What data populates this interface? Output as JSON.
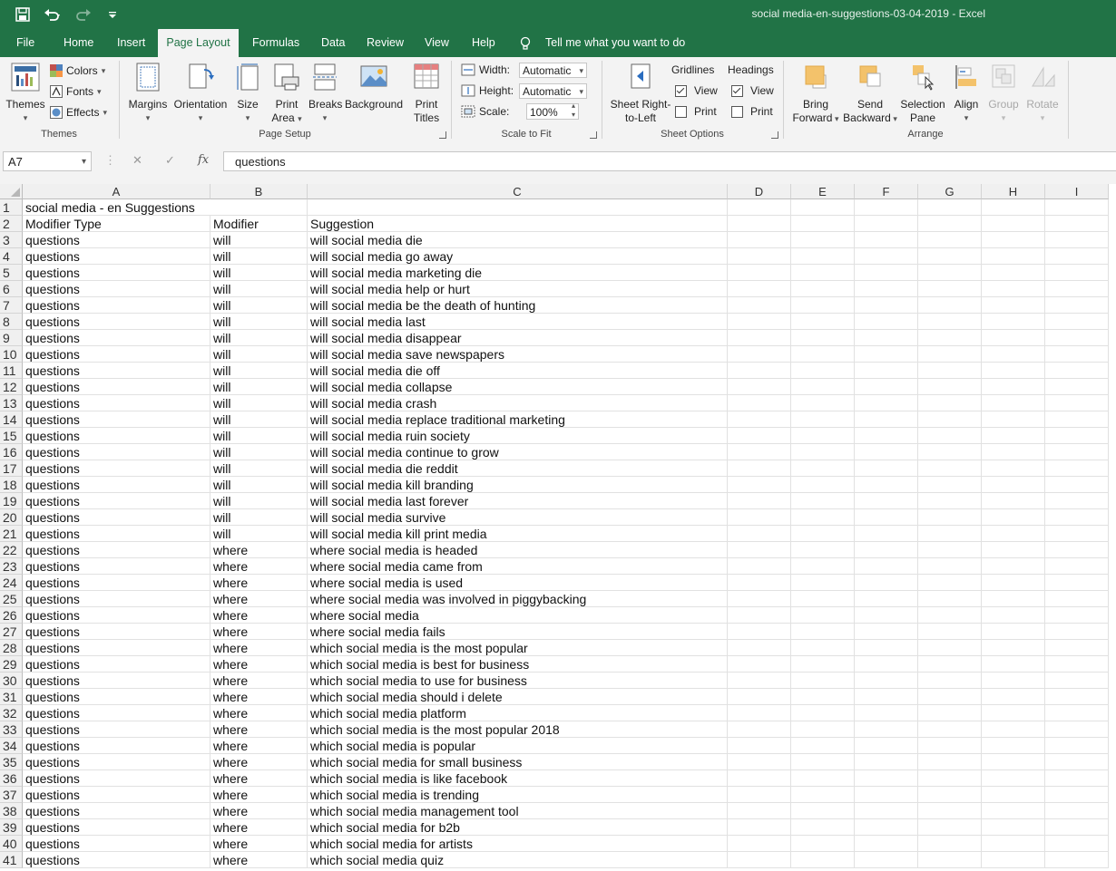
{
  "window": {
    "doc_title": "social media-en-suggestions-03-04-2019",
    "separator": " - ",
    "app_name": "Excel"
  },
  "tabs": [
    "File",
    "Home",
    "Insert",
    "Page Layout",
    "Formulas",
    "Data",
    "Review",
    "View",
    "Help"
  ],
  "active_tab": "Page Layout",
  "tell_me": "Tell me what you want to do",
  "ribbon": {
    "themes": {
      "themes_label": "Themes",
      "colors": "Colors",
      "fonts": "Fonts",
      "effects": "Effects",
      "group": "Themes"
    },
    "page_setup": {
      "margins": "Margins",
      "orientation": "Orientation",
      "size": "Size",
      "print_area_1": "Print",
      "print_area_2": "Area",
      "breaks": "Breaks",
      "background": "Background",
      "print_titles_1": "Print",
      "print_titles_2": "Titles",
      "group": "Page Setup"
    },
    "scale_to_fit": {
      "width_label": "Width:",
      "width_value": "Automatic",
      "height_label": "Height:",
      "height_value": "Automatic",
      "scale_label": "Scale:",
      "scale_value": "100%",
      "group": "Scale to Fit"
    },
    "sheet_options": {
      "rtl_1": "Sheet Right-",
      "rtl_2": "to-Left",
      "gridlines": "Gridlines",
      "headings": "Headings",
      "view": "View",
      "print": "Print",
      "group": "Sheet Options"
    },
    "arrange": {
      "bring_1": "Bring",
      "bring_2": "Forward",
      "send_1": "Send",
      "send_2": "Backward",
      "selection_1": "Selection",
      "selection_2": "Pane",
      "align": "Align",
      "group_btn": "Group",
      "rotate": "Rotate",
      "group": "Arrange"
    }
  },
  "formula_bar": {
    "name_box": "A7",
    "content": "questions"
  },
  "columns": [
    "A",
    "B",
    "C",
    "D",
    "E",
    "F",
    "G",
    "H",
    "I"
  ],
  "sheet": {
    "row1": {
      "a": "social media - en Suggestions",
      "b": "",
      "c": ""
    },
    "row2": {
      "a": "Modifier Type",
      "b": "Modifier",
      "c": "Suggestion"
    },
    "rows": [
      [
        "questions",
        "will",
        "will social media die"
      ],
      [
        "questions",
        "will",
        "will social media go away"
      ],
      [
        "questions",
        "will",
        "will social media marketing die"
      ],
      [
        "questions",
        "will",
        "will social media help or hurt"
      ],
      [
        "questions",
        "will",
        "will social media be the death of hunting"
      ],
      [
        "questions",
        "will",
        "will social media last"
      ],
      [
        "questions",
        "will",
        "will social media disappear"
      ],
      [
        "questions",
        "will",
        "will social media save newspapers"
      ],
      [
        "questions",
        "will",
        "will social media die off"
      ],
      [
        "questions",
        "will",
        "will social media collapse"
      ],
      [
        "questions",
        "will",
        "will social media crash"
      ],
      [
        "questions",
        "will",
        "will social media replace traditional marketing"
      ],
      [
        "questions",
        "will",
        "will social media ruin society"
      ],
      [
        "questions",
        "will",
        "will social media continue to grow"
      ],
      [
        "questions",
        "will",
        "will social media die reddit"
      ],
      [
        "questions",
        "will",
        "will social media kill branding"
      ],
      [
        "questions",
        "will",
        "will social media last forever"
      ],
      [
        "questions",
        "will",
        "will social media survive"
      ],
      [
        "questions",
        "will",
        "will social media kill print media"
      ],
      [
        "questions",
        "where",
        "where social media is headed"
      ],
      [
        "questions",
        "where",
        "where social media came from"
      ],
      [
        "questions",
        "where",
        "where social media is used"
      ],
      [
        "questions",
        "where",
        "where social media was involved in piggybacking"
      ],
      [
        "questions",
        "where",
        "where social media"
      ],
      [
        "questions",
        "where",
        "where social media fails"
      ],
      [
        "questions",
        "where",
        "which social media is the most popular"
      ],
      [
        "questions",
        "where",
        "which social media is best for business"
      ],
      [
        "questions",
        "where",
        "which social media to use for business"
      ],
      [
        "questions",
        "where",
        "which social media should i delete"
      ],
      [
        "questions",
        "where",
        "which social media platform"
      ],
      [
        "questions",
        "where",
        "which social media is the most popular 2018"
      ],
      [
        "questions",
        "where",
        "which social media is popular"
      ],
      [
        "questions",
        "where",
        "which social media for small business"
      ],
      [
        "questions",
        "where",
        "which social media is like facebook"
      ],
      [
        "questions",
        "where",
        "which social media is trending"
      ],
      [
        "questions",
        "where",
        "which social media management tool"
      ],
      [
        "questions",
        "where",
        "which social media for b2b"
      ],
      [
        "questions",
        "where",
        "which social media for artists"
      ],
      [
        "questions",
        "where",
        "which social media quiz"
      ]
    ]
  },
  "colors": {
    "brand": "#217346",
    "ribbon_bg": "#f3f3f3"
  }
}
